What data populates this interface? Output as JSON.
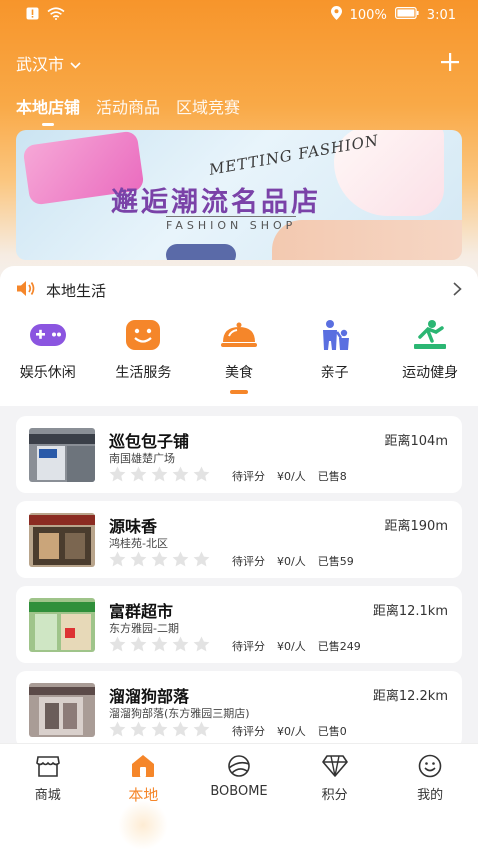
{
  "status_bar": {
    "battery": "100%",
    "time": "3:01"
  },
  "header": {
    "city": "武汉市",
    "add_icon": "plus-icon"
  },
  "tabs": [
    {
      "label": "本地店铺",
      "active": true
    },
    {
      "label": "活动商品",
      "active": false
    },
    {
      "label": "区域竞赛",
      "active": false
    }
  ],
  "banner": {
    "line1": "METTING FASHION",
    "title": "邂逅潮流名品店",
    "subtitle": "FASHION SHOP"
  },
  "local_life": {
    "title": "本地生活"
  },
  "categories": [
    {
      "label": "娱乐休闲",
      "icon": "gamepad-icon",
      "color": "#8b55e0"
    },
    {
      "label": "生活服务",
      "icon": "smile-icon",
      "color": "#f5862a"
    },
    {
      "label": "美食",
      "icon": "food-cloche-icon",
      "color": "#f5862a",
      "active": true
    },
    {
      "label": "亲子",
      "icon": "parent-child-icon",
      "color": "#5a6fe0"
    },
    {
      "label": "运动健身",
      "icon": "fitness-icon",
      "color": "#2bb673"
    }
  ],
  "shops": [
    {
      "name": "巡包包子铺",
      "address": "南国雄楚广场",
      "distance": "距离104m",
      "rating": "待评分",
      "price": "¥0/人",
      "sold": "已售8"
    },
    {
      "name": "源味香",
      "address": "鸿桂苑-北区",
      "distance": "距离190m",
      "rating": "待评分",
      "price": "¥0/人",
      "sold": "已售59"
    },
    {
      "name": "富群超市",
      "address": "东方雅园-二期",
      "distance": "距离12.1km",
      "rating": "待评分",
      "price": "¥0/人",
      "sold": "已售249"
    },
    {
      "name": "溜溜狗部落",
      "address": "溜溜狗部落(东方雅园三期店)",
      "distance": "距离12.2km",
      "rating": "待评分",
      "price": "¥0/人",
      "sold": "已售0"
    }
  ],
  "bottom_nav": [
    {
      "label": "商城",
      "icon": "store-icon"
    },
    {
      "label": "本地",
      "icon": "home-icon",
      "active": true
    },
    {
      "label": "BOBOME",
      "icon": "planet-icon"
    },
    {
      "label": "积分",
      "icon": "diamond-icon"
    },
    {
      "label": "我的",
      "icon": "smiley-icon"
    }
  ],
  "colors": {
    "accent": "#f5862a",
    "star": "#e3e3e3"
  }
}
